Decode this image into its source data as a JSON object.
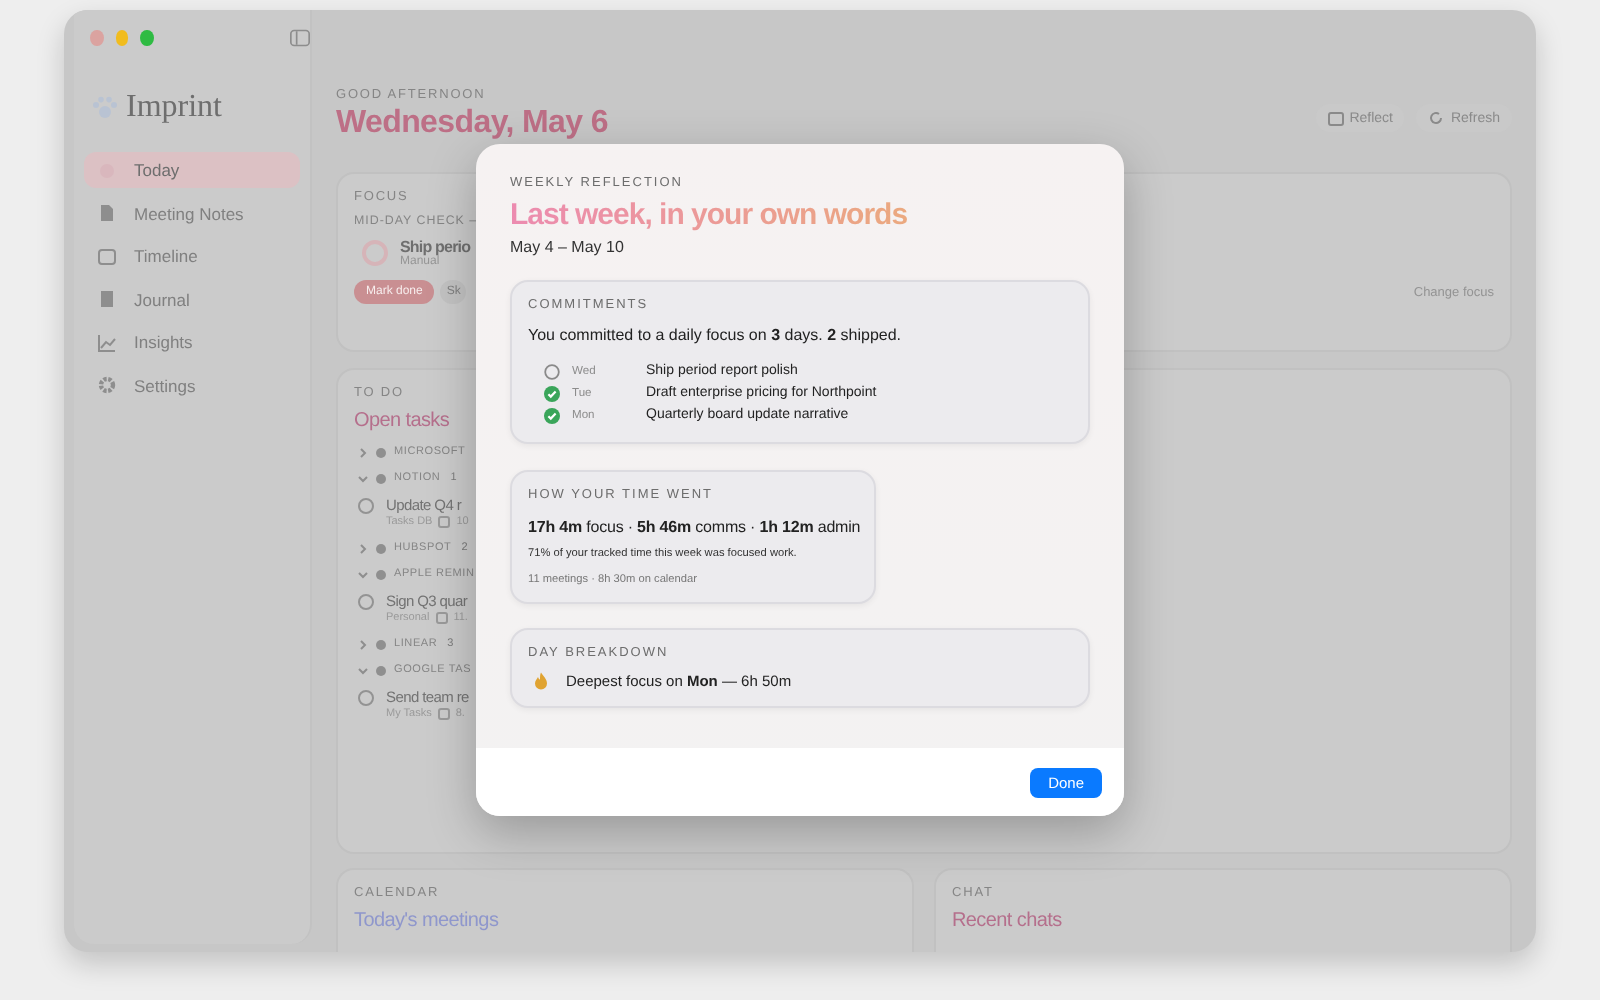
{
  "sidebar": {
    "app_name": "Imprint",
    "items": [
      {
        "label": "Today",
        "selected": true
      },
      {
        "label": "Meeting Notes",
        "selected": false
      },
      {
        "label": "Timeline",
        "selected": false
      },
      {
        "label": "Journal",
        "selected": false
      },
      {
        "label": "Insights",
        "selected": false
      },
      {
        "label": "Settings",
        "selected": false
      }
    ]
  },
  "header": {
    "greeting": "GOOD AFTERNOON",
    "date": "Wednesday, May 6",
    "actions": [
      "Reflect",
      "Refresh"
    ]
  },
  "focus_card": {
    "label": "FOCUS",
    "check_label": "MID-DAY CHECK –",
    "task": "Ship perio",
    "source": "Manual",
    "buttons": [
      "Mark done",
      "Sk"
    ],
    "change_link": "Change focus"
  },
  "todo": {
    "label": "TO DO",
    "title": "Open tasks",
    "groups": [
      {
        "name": "MICROSOFT",
        "expanded": false
      },
      {
        "name": "NOTION",
        "count": "1",
        "expanded": true,
        "tasks": [
          {
            "title": "Update Q4 r",
            "list": "Tasks DB",
            "due": "10",
            "done": false
          }
        ]
      },
      {
        "name": "HUBSPOT",
        "count": "2",
        "expanded": false
      },
      {
        "name": "APPLE REMIN",
        "expanded": true,
        "tasks": [
          {
            "title": "Sign Q3 quar",
            "list": "Personal",
            "due": "11.",
            "done": false
          }
        ]
      },
      {
        "name": "LINEAR",
        "count": "3",
        "expanded": false
      },
      {
        "name": "GOOGLE TAS",
        "expanded": true,
        "tasks": [
          {
            "title": "Send team re",
            "list": "My Tasks",
            "due": "8.",
            "done": false
          }
        ]
      }
    ]
  },
  "calendar": {
    "label": "CALENDAR",
    "title": "Today's meetings"
  },
  "chat": {
    "label": "CHAT",
    "title": "Recent chats"
  },
  "modal": {
    "eyebrow": "WEEKLY REFLECTION",
    "title": "Last week, in your own words",
    "date_range": "May 4 – May 10",
    "commitments": {
      "label": "COMMITMENTS",
      "summary": "You committed to a daily focus on **3** days. **2** shipped.",
      "items": [
        {
          "day": "Wed",
          "text": "Ship period report polish",
          "done": false
        },
        {
          "day": "Tue",
          "text": "Draft enterprise pricing for Northpoint",
          "done": true
        },
        {
          "day": "Mon",
          "text": "Quarterly board update narrative",
          "done": true
        }
      ]
    },
    "time": {
      "label": "HOW YOUR TIME WENT",
      "summary": "**17h 4m** focus · **5h 46m** comms · **1h 12m** admin",
      "note": "71% of your tracked time this week was focused work.",
      "meta": "11 meetings · 8h 30m on calendar"
    },
    "breakdown": {
      "label": "DAY BREAKDOWN",
      "text": "Deepest focus on **Mon** — 6h 50m"
    },
    "done_button": "Done"
  }
}
